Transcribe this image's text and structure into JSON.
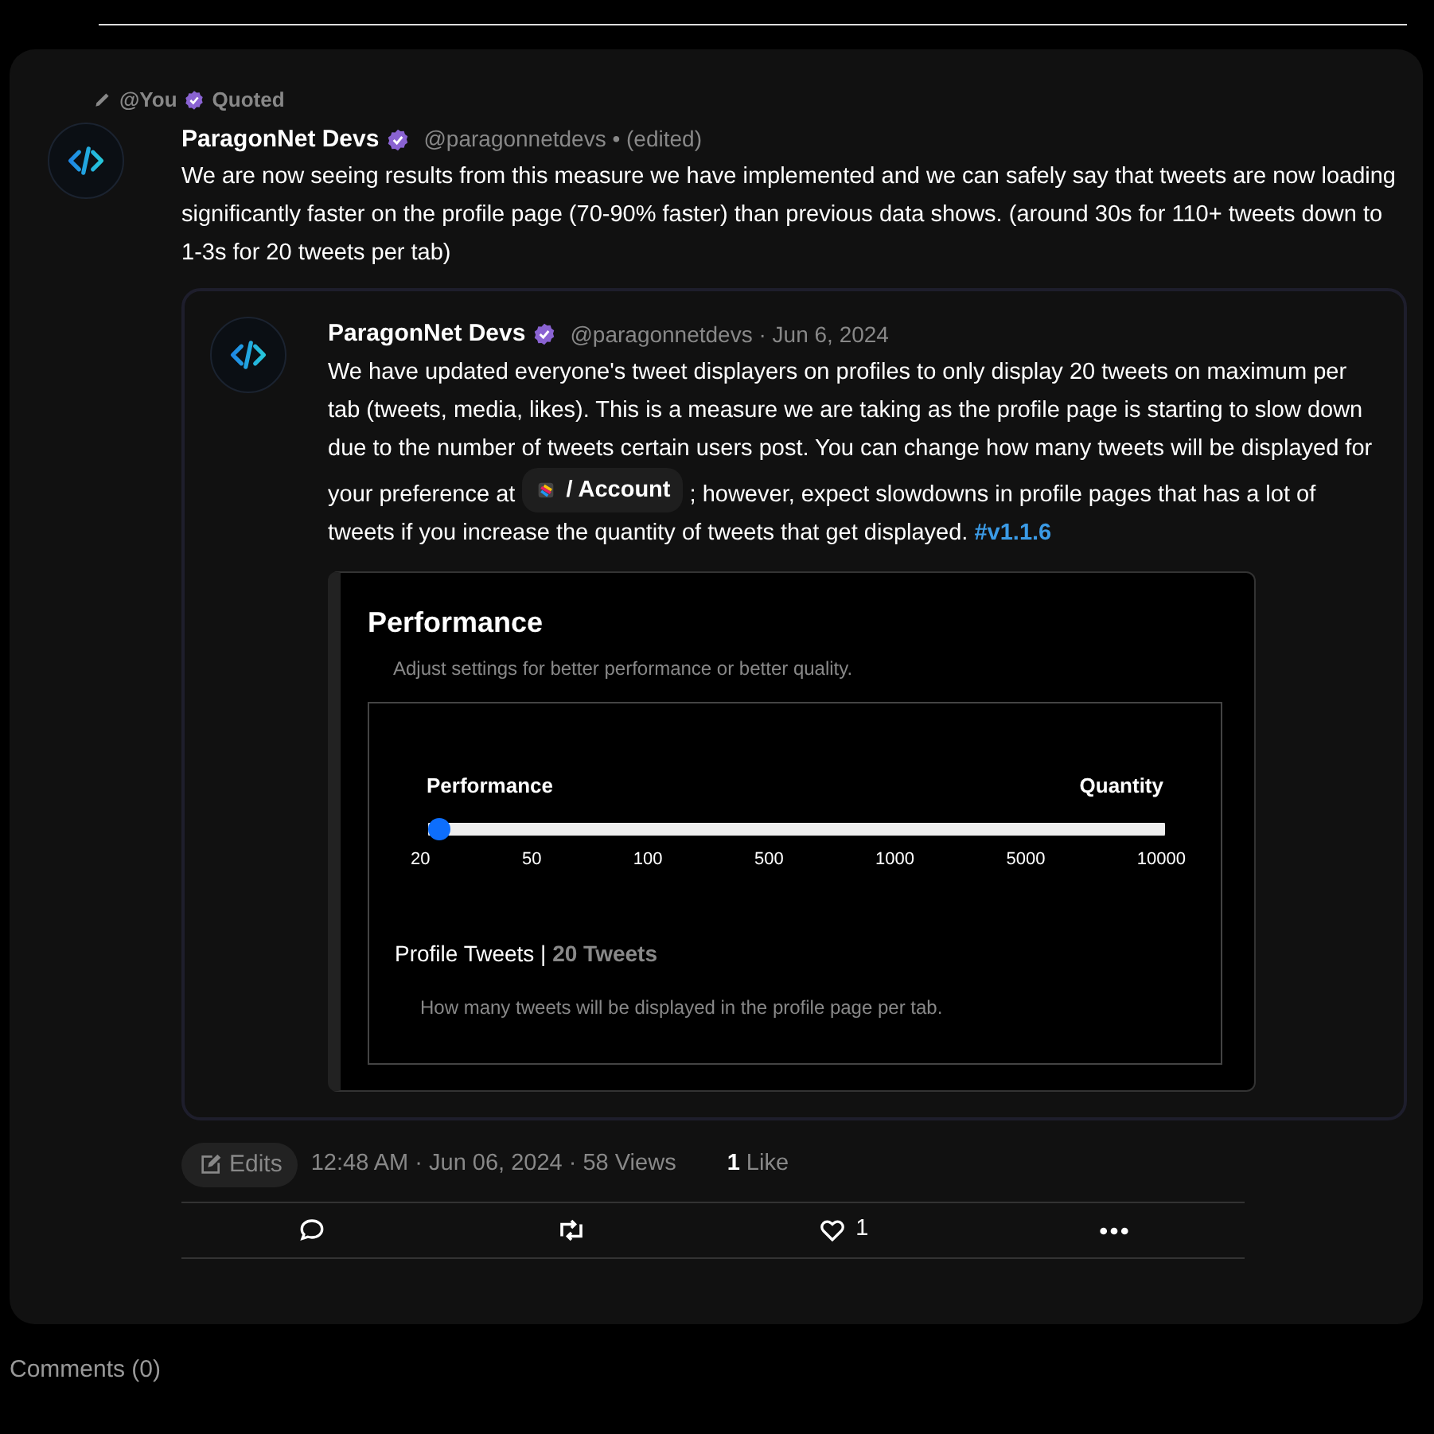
{
  "quote_context": {
    "author": "@You",
    "label": "Quoted"
  },
  "post": {
    "author": "ParagonNet Devs",
    "verified": true,
    "handle": "@paragonnetdevs • (edited)",
    "text": "We are now seeing results from this measure we have implemented and we can safely say that tweets are now loading significantly faster on the profile page (70-90% faster) than previous data shows. (around 30s for 110+ tweets down to 1-3s for 20 tweets per tab)"
  },
  "quoted_post": {
    "author": "ParagonNet Devs",
    "verified": true,
    "handle": "@paragonnetdevs · Jun 6, 2024",
    "text_before": "We have updated everyone's tweet displayers on profiles to only display 20 tweets on maximum per tab (tweets, media, likes). This is a measure we are taking as the profile page is starting to slow down due to the number of tweets certain users post. You can change how many tweets will be displayed for your preference at",
    "chip": "/ Account",
    "text_after": "; however, expect slowdowns in profile pages that has a lot of tweets if you increase the quantity of tweets that get displayed.",
    "hashtag": "#v1.1.6",
    "screenshot": {
      "title": "Performance",
      "subtitle": "Adjust settings for better performance or better quality.",
      "slider": {
        "left_label": "Performance",
        "right_label": "Quantity",
        "level": 0,
        "ticks": [
          "20",
          "50",
          "100",
          "500",
          "1000",
          "5000",
          "10000"
        ]
      },
      "setting_label": "Profile Tweets |",
      "setting_value": "20 Tweets",
      "help": "How many tweets will be displayed in the profile page per tab."
    }
  },
  "footer": {
    "edits_button": "Edits",
    "timestamp": "12:48 AM · Jun 06, 2024 · 58 Views",
    "likes_count": "1",
    "likes_label": "Like"
  },
  "actions": [
    {
      "kind": "comment"
    },
    {
      "kind": "repost"
    },
    {
      "kind": "like",
      "count": "1"
    },
    {
      "kind": "more"
    }
  ],
  "comments_label": "Comments (0)"
}
